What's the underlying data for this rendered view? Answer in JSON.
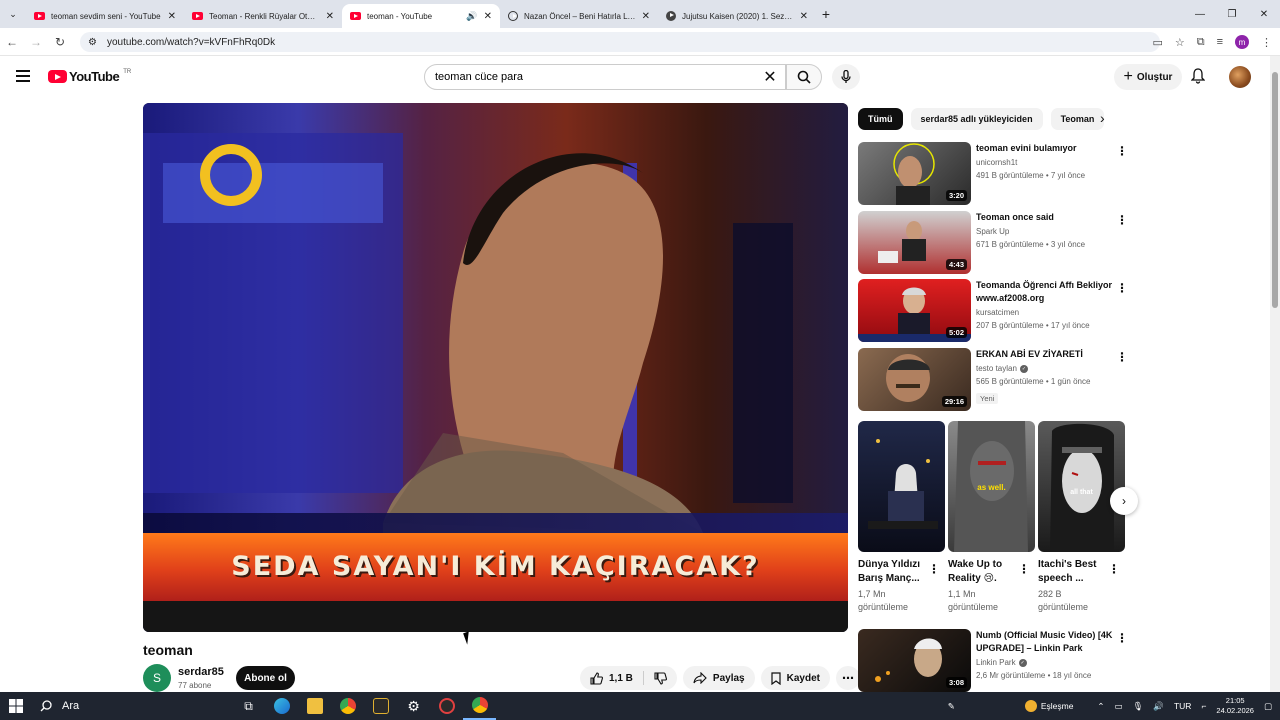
{
  "browser": {
    "tabs": [
      {
        "title": "teoman sevdim seni - YouTube",
        "icon": "youtube-icon",
        "active": false
      },
      {
        "title": "Teoman - Renkli Rüyalar Oteli (O",
        "icon": "youtube-icon",
        "active": false
      },
      {
        "title": "teoman - YouTube",
        "icon": "youtube-icon",
        "active": true
      },
      {
        "title": "Nazan Öncel – Beni Hatırla Lyric",
        "icon": "moon-icon",
        "active": false
      },
      {
        "title": "Jujutsu Kaisen (2020) 1. Sezon 4",
        "icon": "site-icon",
        "active": false
      }
    ],
    "url": "youtube.com/watch?v=kVFnFhRq0Dk",
    "profile_initial": "m"
  },
  "masthead": {
    "logo_text": "YouTube",
    "country_code": "TR",
    "search_query": "teoman cüce para",
    "create_label": "Oluştur"
  },
  "player": {
    "lower_third": "SEDA SAYAN'I KİM KAÇIRACAK?"
  },
  "video": {
    "title": "teoman",
    "channel_initial": "S",
    "channel_name": "serdar85",
    "subscribers": "77 abone",
    "subscribe_label": "Abone ol",
    "likes": "1,1 B",
    "share_label": "Paylaş",
    "save_label": "Kaydet"
  },
  "chips": [
    "Tümü",
    "serdar85 adlı yükleyiciden",
    "Teoman"
  ],
  "recommendations": [
    {
      "title": "teoman evini bulamıyor",
      "channel": "unicornsh1t",
      "meta": "491 B görüntüleme • 7 yıl önce",
      "duration": "3:20",
      "verified": false,
      "thumb": "#5a5a5a"
    },
    {
      "title": "Teoman once said",
      "channel": "Spark Up",
      "meta": "671 B görüntüleme • 3 yıl önce",
      "duration": "4:43",
      "verified": false,
      "thumb": "#c84040"
    },
    {
      "title": "Teomanda Öğrenci Affı Bekliyor www.af2008.org",
      "channel": "kursatcimen",
      "meta": "207 B görüntüleme • 17 yıl önce",
      "duration": "5:02",
      "verified": false,
      "thumb": "#c8101a"
    },
    {
      "title": "ERKAN ABİ EV ZİYARETİ",
      "channel": "testo taylan",
      "meta": "565 B görüntüleme • 1 gün önce",
      "duration": "29:16",
      "verified": true,
      "badge": "Yeni",
      "thumb": "#6a5040"
    }
  ],
  "shorts": [
    {
      "title": "Dünya Yıldızı Barış Manç...",
      "views": "1,7 Mn görüntüleme",
      "thumb": "#1a1f3a"
    },
    {
      "title": "Wake Up to Reality 😢.",
      "views": "1,1 Mn görüntüleme",
      "thumb": "#6a6a6a",
      "overlay": "as well."
    },
    {
      "title": "Itachi's  Best speech ...",
      "views": "282 B görüntüleme",
      "thumb": "#3a3a3a",
      "overlay": "all that"
    }
  ],
  "bottom_rec": {
    "title": "Numb (Official Music Video) [4K UPGRADE] – Linkin Park",
    "channel": "Linkin Park",
    "meta": "2,6 Mr görüntüleme • 18 yıl önce",
    "duration": "3:08",
    "verified": true
  },
  "taskbar": {
    "search_label": "Ara",
    "weather_label": "Eşleşme",
    "lang": "TUR",
    "time": "21:05",
    "date": "24.02.2026"
  },
  "colors": {
    "accent": "#ff0033",
    "chip_active": "#0f0f0f"
  }
}
